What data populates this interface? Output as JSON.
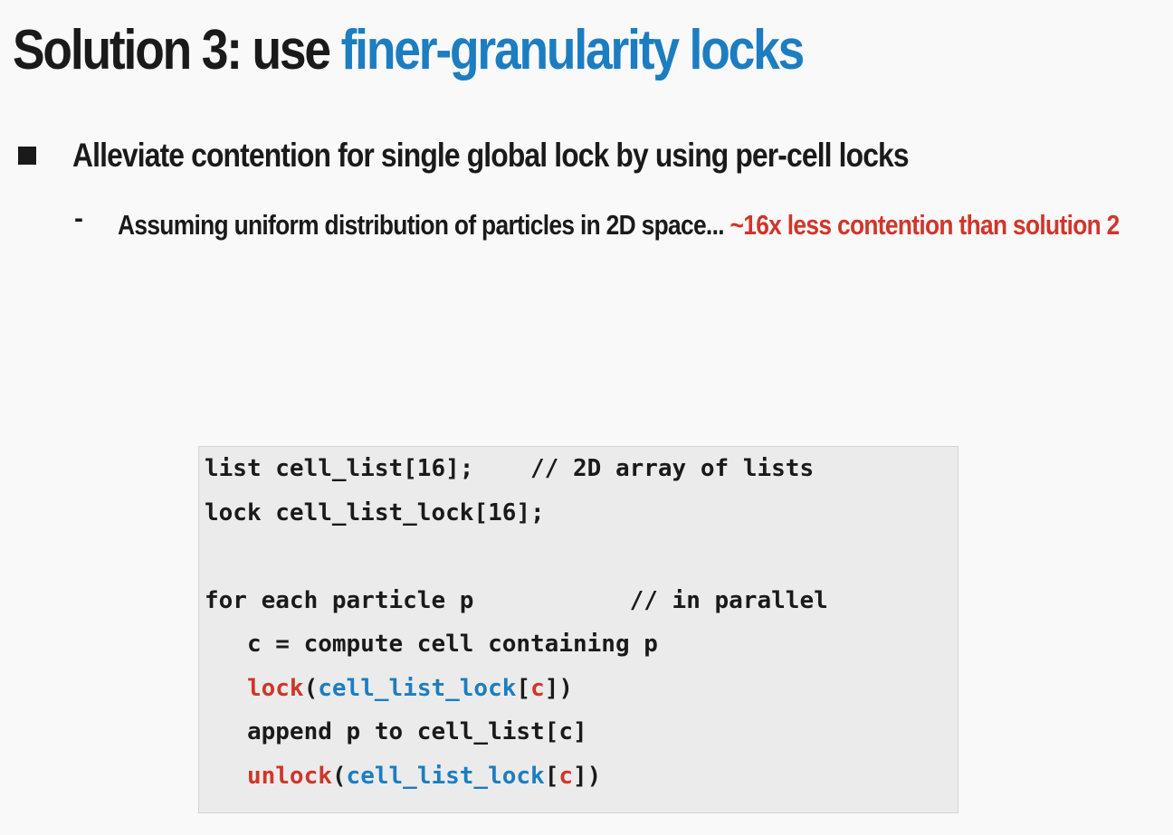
{
  "slide": {
    "title_plain": "Solution 3: use ",
    "title_accent": "finer-granularity locks",
    "bullet": "Alleviate contention for single global lock by using per-cell locks",
    "sub_dash": "-",
    "sub_text": "Assuming uniform distribution of particles in 2D space... ",
    "sub_highlight": "~16x less contention than solution 2"
  },
  "code": {
    "line1": "list cell_list[16];    // 2D array of lists",
    "line2": "lock cell_list_lock[16];",
    "line3": "",
    "line4": "for each particle p           // in parallel",
    "line5": "   c = compute cell containing p",
    "line6": {
      "indent": "   ",
      "fn": "lock",
      "open": "(",
      "arr": "cell_list_lock",
      "lb": "[",
      "idx": "c",
      "rb": "]",
      "close": ")"
    },
    "line7": "   append p to cell_list[c]",
    "line8": {
      "indent": "   ",
      "fn": "unlock",
      "open": "(",
      "arr": "cell_list_lock",
      "lb": "[",
      "idx": "c",
      "rb": "]",
      "close": ")"
    }
  },
  "colors": {
    "accent_blue": "#1c7dc1",
    "accent_red": "#d0362a",
    "code_background": "#ebebeb"
  }
}
